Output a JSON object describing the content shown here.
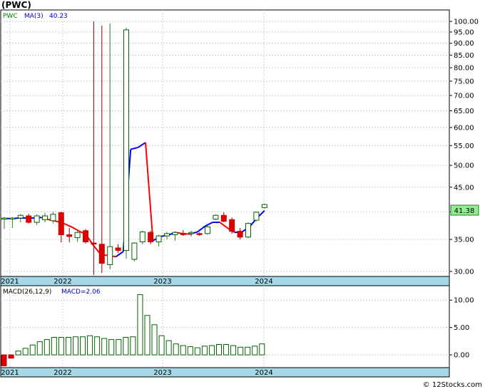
{
  "header": {
    "title": "(PWC)"
  },
  "chart_data": [
    {
      "type": "candlestick",
      "symbol": "PWC",
      "legend": {
        "symbol_label": "PWC",
        "ma_label": "MA(3)",
        "ma_value": "40.23"
      },
      "last_price_label": "41.38",
      "y_axis": {
        "scale": "log",
        "ylim": [
          29,
          105
        ],
        "ticks": [
          "100.00",
          "95.00",
          "90.00",
          "85.00",
          "80.00",
          "75.00",
          "70.00",
          "65.00",
          "60.00",
          "55.00",
          "50.00",
          "45.00",
          "40.00",
          "35.00",
          "30.00"
        ]
      },
      "x_ticks": [
        "2021",
        "2022",
        "2023",
        "2024"
      ],
      "candles": [
        {
          "o": 38.6,
          "h": 39.0,
          "l": 36.8,
          "c": 38.8
        },
        {
          "o": 38.6,
          "h": 39.0,
          "l": 37.0,
          "c": 38.8
        },
        {
          "o": 38.8,
          "h": 39.5,
          "l": 38.0,
          "c": 39.3
        },
        {
          "o": 39.2,
          "h": 39.6,
          "l": 37.8,
          "c": 38.0
        },
        {
          "o": 38.0,
          "h": 39.5,
          "l": 37.5,
          "c": 39.2
        },
        {
          "o": 38.5,
          "h": 39.8,
          "l": 38.0,
          "c": 39.2
        },
        {
          "o": 38.3,
          "h": 40.0,
          "l": 37.8,
          "c": 39.5
        },
        {
          "o": 39.8,
          "h": 40.0,
          "l": 34.5,
          "c": 35.8
        },
        {
          "o": 35.8,
          "h": 37.0,
          "l": 34.5,
          "c": 35.5
        },
        {
          "o": 35.3,
          "h": 36.7,
          "l": 34.6,
          "c": 36.2
        },
        {
          "o": 36.5,
          "h": 36.8,
          "l": 34.3,
          "c": 34.6
        },
        {
          "o": 34.4,
          "h": 100.0,
          "l": 29.5,
          "c": 34.3
        },
        {
          "o": 34.2,
          "h": 98.0,
          "l": 29.8,
          "c": 31.2
        },
        {
          "o": 31.0,
          "h": 99.0,
          "l": 30.3,
          "c": 33.8
        },
        {
          "o": 33.6,
          "h": 34.2,
          "l": 32.8,
          "c": 33.2
        },
        {
          "o": 33.2,
          "h": 97.0,
          "l": 31.9,
          "c": 96.0
        },
        {
          "o": 31.8,
          "h": 34.5,
          "l": 31.5,
          "c": 34.4
        },
        {
          "o": 34.6,
          "h": 36.5,
          "l": 34.2,
          "c": 36.3
        },
        {
          "o": 36.2,
          "h": 36.5,
          "l": 34.2,
          "c": 34.6
        },
        {
          "o": 34.6,
          "h": 35.8,
          "l": 33.8,
          "c": 35.6
        },
        {
          "o": 35.6,
          "h": 36.3,
          "l": 35.0,
          "c": 36.0
        },
        {
          "o": 35.8,
          "h": 36.4,
          "l": 34.8,
          "c": 36.2
        },
        {
          "o": 36.0,
          "h": 36.6,
          "l": 35.6,
          "c": 35.9
        },
        {
          "o": 36.0,
          "h": 36.5,
          "l": 35.5,
          "c": 36.2
        },
        {
          "o": 36.0,
          "h": 36.2,
          "l": 35.6,
          "c": 35.9
        },
        {
          "o": 36.0,
          "h": 37.5,
          "l": 35.8,
          "c": 37.2
        },
        {
          "o": 38.6,
          "h": 39.5,
          "l": 38.4,
          "c": 39.3
        },
        {
          "o": 39.3,
          "h": 39.9,
          "l": 38.0,
          "c": 38.2
        },
        {
          "o": 38.5,
          "h": 38.9,
          "l": 36.0,
          "c": 36.4
        },
        {
          "o": 36.4,
          "h": 37.0,
          "l": 35.0,
          "c": 35.4
        },
        {
          "o": 35.4,
          "h": 38.0,
          "l": 35.2,
          "c": 37.8
        },
        {
          "o": 38.4,
          "h": 40.0,
          "l": 38.2,
          "c": 39.9
        },
        {
          "o": 40.8,
          "h": 41.6,
          "l": 40.6,
          "c": 41.4
        }
      ],
      "ma_line": [
        38.7,
        38.7,
        38.8,
        38.8,
        38.8,
        38.9,
        38.5,
        38.2,
        37.8,
        37.2,
        36.5,
        35.8,
        34.0,
        32.5,
        32.4,
        32.2,
        33.0,
        54.0,
        54.5,
        55.8,
        34.8,
        35.5,
        35.7,
        36.2,
        36.0,
        35.9,
        36.3,
        37.3,
        38.0,
        38.0,
        37.0,
        36.2,
        36.3,
        37.2,
        38.8,
        40.2
      ],
      "macd": {
        "label": "MACD(26,12,9)",
        "value_label": "MACD=2.06",
        "ticks": [
          "10.00",
          "5.00",
          "0.00"
        ],
        "ylim": [
          -2.2,
          12.5
        ],
        "histogram": [
          -2.0,
          -0.6,
          0.7,
          1.2,
          1.8,
          2.4,
          2.8,
          3.2,
          3.2,
          3.2,
          3.3,
          3.3,
          3.5,
          3.3,
          3.0,
          2.8,
          2.8,
          3.2,
          3.3,
          11.0,
          7.2,
          5.5,
          3.5,
          2.6,
          2.0,
          1.7,
          1.5,
          1.3,
          1.6,
          1.7,
          1.9,
          1.9,
          1.7,
          1.4,
          1.4,
          1.6,
          2.0
        ]
      }
    }
  ],
  "footer": {
    "watermark": "© 12Stocks.com"
  }
}
